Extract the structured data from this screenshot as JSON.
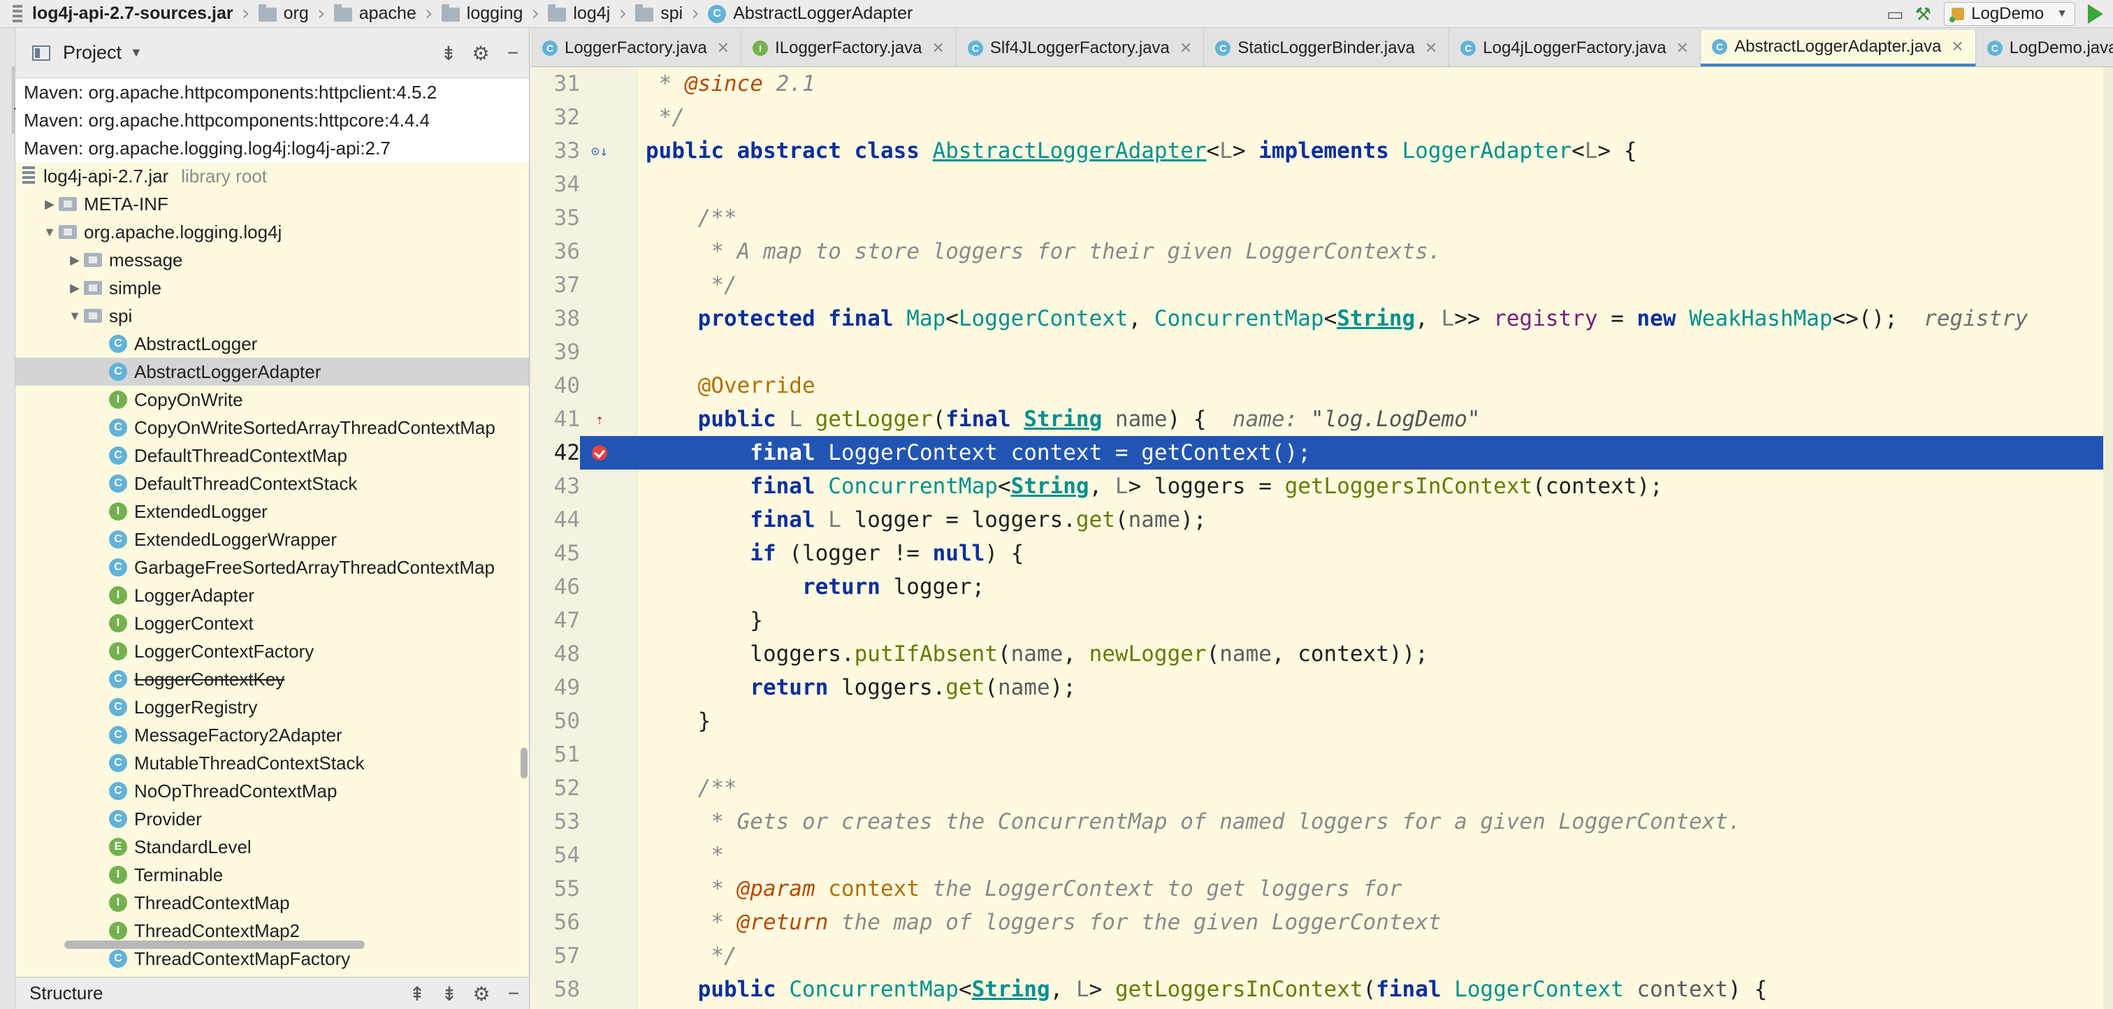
{
  "navbar": {
    "crumbs": [
      {
        "label": "log4j-api-2.7-sources.jar",
        "type": "jar"
      },
      {
        "label": "org",
        "type": "folder"
      },
      {
        "label": "apache",
        "type": "folder"
      },
      {
        "label": "logging",
        "type": "folder"
      },
      {
        "label": "log4j",
        "type": "folder"
      },
      {
        "label": "spi",
        "type": "folder"
      },
      {
        "label": "AbstractLoggerAdapter",
        "type": "class"
      }
    ],
    "run_config": "LogDemo",
    "icons": [
      "layout-icon",
      "build-hammer-icon",
      "run-icon"
    ]
  },
  "toolstrip": {
    "label": "1: Project"
  },
  "project_panel": {
    "title": "Project",
    "header_icons": [
      "collapse-icon",
      "gear-icon",
      "minimize-icon"
    ],
    "tree": [
      {
        "label": "Maven: org.apache.httpcomponents:httpclient:4.5.2",
        "depth": 0,
        "kind": "lib"
      },
      {
        "label": "Maven: org.apache.httpcomponents:httpcore:4.4.4",
        "depth": 0,
        "kind": "lib"
      },
      {
        "label": "Maven: org.apache.logging.log4j:log4j-api:2.7",
        "depth": 0,
        "kind": "lib"
      },
      {
        "label": "log4j-api-2.7.jar",
        "suffix": "library root",
        "depth": 0,
        "kind": "jar"
      },
      {
        "label": "META-INF",
        "depth": 1,
        "kind": "folder",
        "expander": "collapsed"
      },
      {
        "label": "org.apache.logging.log4j",
        "depth": 1,
        "kind": "package",
        "expander": "expanded"
      },
      {
        "label": "message",
        "depth": 2,
        "kind": "package",
        "expander": "collapsed"
      },
      {
        "label": "simple",
        "depth": 2,
        "kind": "package",
        "expander": "collapsed"
      },
      {
        "label": "spi",
        "depth": 2,
        "kind": "package",
        "expander": "expanded"
      },
      {
        "label": "AbstractLogger",
        "depth": 3,
        "kind": "class"
      },
      {
        "label": "AbstractLoggerAdapter",
        "depth": 3,
        "kind": "class",
        "selected": true
      },
      {
        "label": "CopyOnWrite",
        "depth": 3,
        "kind": "interface"
      },
      {
        "label": "CopyOnWriteSortedArrayThreadContextMap",
        "depth": 3,
        "kind": "class"
      },
      {
        "label": "DefaultThreadContextMap",
        "depth": 3,
        "kind": "class"
      },
      {
        "label": "DefaultThreadContextStack",
        "depth": 3,
        "kind": "class"
      },
      {
        "label": "ExtendedLogger",
        "depth": 3,
        "kind": "interface"
      },
      {
        "label": "ExtendedLoggerWrapper",
        "depth": 3,
        "kind": "class"
      },
      {
        "label": "GarbageFreeSortedArrayThreadContextMap",
        "depth": 3,
        "kind": "class"
      },
      {
        "label": "LoggerAdapter",
        "depth": 3,
        "kind": "interface"
      },
      {
        "label": "LoggerContext",
        "depth": 3,
        "kind": "interface"
      },
      {
        "label": "LoggerContextFactory",
        "depth": 3,
        "kind": "interface"
      },
      {
        "label": "LoggerContextKey",
        "depth": 3,
        "kind": "class",
        "deprecated": true
      },
      {
        "label": "LoggerRegistry",
        "depth": 3,
        "kind": "class"
      },
      {
        "label": "MessageFactory2Adapter",
        "depth": 3,
        "kind": "class"
      },
      {
        "label": "MutableThreadContextStack",
        "depth": 3,
        "kind": "class"
      },
      {
        "label": "NoOpThreadContextMap",
        "depth": 3,
        "kind": "class"
      },
      {
        "label": "Provider",
        "depth": 3,
        "kind": "class"
      },
      {
        "label": "StandardLevel",
        "depth": 3,
        "kind": "enum"
      },
      {
        "label": "Terminable",
        "depth": 3,
        "kind": "interface"
      },
      {
        "label": "ThreadContextMap",
        "depth": 3,
        "kind": "interface"
      },
      {
        "label": "ThreadContextMap2",
        "depth": 3,
        "kind": "interface"
      },
      {
        "label": "ThreadContextMapFactory",
        "depth": 3,
        "kind": "class"
      }
    ],
    "structure_title": "Structure"
  },
  "tabs": [
    {
      "label": "LoggerFactory.java",
      "kind": "class",
      "active": false
    },
    {
      "label": "ILoggerFactory.java",
      "kind": "interface",
      "active": false
    },
    {
      "label": "Slf4JLoggerFactory.java",
      "kind": "class",
      "active": false
    },
    {
      "label": "StaticLoggerBinder.java",
      "kind": "class",
      "active": false
    },
    {
      "label": "Log4jLoggerFactory.java",
      "kind": "class",
      "active": false
    },
    {
      "label": "AbstractLoggerAdapter.java",
      "kind": "class",
      "active": true
    },
    {
      "label": "LogDemo.java",
      "kind": "class",
      "active": false
    }
  ],
  "editor": {
    "current_line": 42,
    "lines": [
      {
        "n": 31,
        "tokens": [
          [
            "cm",
            " * "
          ],
          [
            "tag",
            "@since"
          ],
          [
            "cm",
            " 2.1"
          ]
        ]
      },
      {
        "n": 32,
        "tokens": [
          [
            "cm",
            " */"
          ]
        ]
      },
      {
        "n": 33,
        "mark": "implements",
        "tokens": [
          [
            "kw",
            "public abstract class "
          ],
          [
            "clsdecl",
            "AbstractLoggerAdapter"
          ],
          [
            "punct",
            "<"
          ],
          [
            "tp",
            "L"
          ],
          [
            "punct",
            "> "
          ],
          [
            "kw",
            "implements "
          ],
          [
            "ty",
            "LoggerAdapter"
          ],
          [
            "punct",
            "<"
          ],
          [
            "tp",
            "L"
          ],
          [
            "punct",
            "> {"
          ]
        ]
      },
      {
        "n": 34,
        "tokens": []
      },
      {
        "n": 35,
        "tokens": [
          [
            "cm",
            "    /**"
          ]
        ]
      },
      {
        "n": 36,
        "tokens": [
          [
            "cm",
            "     * A map to store loggers for their given LoggerContexts."
          ]
        ]
      },
      {
        "n": 37,
        "tokens": [
          [
            "cm",
            "     */"
          ]
        ]
      },
      {
        "n": 38,
        "tokens": [
          [
            "punct",
            "    "
          ],
          [
            "kw",
            "protected final "
          ],
          [
            "ty",
            "Map"
          ],
          [
            "punct",
            "<"
          ],
          [
            "ty",
            "LoggerContext"
          ],
          [
            "punct",
            ", "
          ],
          [
            "ty",
            "ConcurrentMap"
          ],
          [
            "punct",
            "<"
          ],
          [
            "tyu",
            "String"
          ],
          [
            "punct",
            ", "
          ],
          [
            "tp",
            "L"
          ],
          [
            "punct",
            ">> "
          ],
          [
            "fld",
            "registry"
          ],
          [
            "punct",
            " = "
          ],
          [
            "kw",
            "new "
          ],
          [
            "ty",
            "WeakHashMap"
          ],
          [
            "punct",
            "<>();  "
          ],
          [
            "hint",
            "registry"
          ]
        ]
      },
      {
        "n": 39,
        "tokens": []
      },
      {
        "n": 40,
        "tokens": [
          [
            "punct",
            "    "
          ],
          [
            "ann",
            "@Override"
          ]
        ]
      },
      {
        "n": 41,
        "mark": "override",
        "tokens": [
          [
            "punct",
            "    "
          ],
          [
            "kw",
            "public "
          ],
          [
            "tp",
            "L "
          ],
          [
            "fn",
            "getLogger"
          ],
          [
            "punct",
            "("
          ],
          [
            "kw",
            "final "
          ],
          [
            "tyu",
            "String"
          ],
          [
            "prm",
            " name"
          ],
          [
            "punct",
            ") {  "
          ],
          [
            "hint",
            "name: "
          ],
          [
            "hint-str",
            "\"log.LogDemo\""
          ]
        ]
      },
      {
        "n": 42,
        "mark": "breakpoint",
        "tokens": [
          [
            "punct",
            "        "
          ],
          [
            "kw",
            "final "
          ],
          [
            "ty",
            "LoggerContext"
          ],
          [
            "punct",
            " context = "
          ],
          [
            "fn",
            "getContext"
          ],
          [
            "punct",
            "();"
          ]
        ]
      },
      {
        "n": 43,
        "tokens": [
          [
            "punct",
            "        "
          ],
          [
            "kw",
            "final "
          ],
          [
            "ty",
            "ConcurrentMap"
          ],
          [
            "punct",
            "<"
          ],
          [
            "tyu",
            "String"
          ],
          [
            "punct",
            ", "
          ],
          [
            "tp",
            "L"
          ],
          [
            "punct",
            "> loggers = "
          ],
          [
            "fn",
            "getLoggersInContext"
          ],
          [
            "punct",
            "(context);"
          ]
        ]
      },
      {
        "n": 44,
        "tokens": [
          [
            "punct",
            "        "
          ],
          [
            "kw",
            "final "
          ],
          [
            "tp",
            "L"
          ],
          [
            "punct",
            " logger = loggers."
          ],
          [
            "fn",
            "get"
          ],
          [
            "punct",
            "("
          ],
          [
            "prm",
            "name"
          ],
          [
            "punct",
            ");"
          ]
        ]
      },
      {
        "n": 45,
        "tokens": [
          [
            "punct",
            "        "
          ],
          [
            "kw",
            "if "
          ],
          [
            "punct",
            "(logger != "
          ],
          [
            "kw",
            "null"
          ],
          [
            "punct",
            ") {"
          ]
        ]
      },
      {
        "n": 46,
        "tokens": [
          [
            "punct",
            "            "
          ],
          [
            "kw",
            "return "
          ],
          [
            "punct",
            "logger;"
          ]
        ]
      },
      {
        "n": 47,
        "tokens": [
          [
            "punct",
            "        }"
          ]
        ]
      },
      {
        "n": 48,
        "tokens": [
          [
            "punct",
            "        loggers."
          ],
          [
            "fn",
            "putIfAbsent"
          ],
          [
            "punct",
            "("
          ],
          [
            "prm",
            "name"
          ],
          [
            "punct",
            ", "
          ],
          [
            "fn",
            "newLogger"
          ],
          [
            "punct",
            "("
          ],
          [
            "prm",
            "name"
          ],
          [
            "punct",
            ", context));"
          ]
        ]
      },
      {
        "n": 49,
        "tokens": [
          [
            "punct",
            "        "
          ],
          [
            "kw",
            "return "
          ],
          [
            "punct",
            "loggers."
          ],
          [
            "fn",
            "get"
          ],
          [
            "punct",
            "("
          ],
          [
            "prm",
            "name"
          ],
          [
            "punct",
            ");"
          ]
        ]
      },
      {
        "n": 50,
        "tokens": [
          [
            "punct",
            "    }"
          ]
        ]
      },
      {
        "n": 51,
        "tokens": []
      },
      {
        "n": 52,
        "tokens": [
          [
            "cm",
            "    /**"
          ]
        ]
      },
      {
        "n": 53,
        "tokens": [
          [
            "cm",
            "     * Gets or creates the ConcurrentMap of named loggers for a given LoggerContext."
          ]
        ]
      },
      {
        "n": 54,
        "tokens": [
          [
            "cm",
            "     *"
          ]
        ]
      },
      {
        "n": 55,
        "tokens": [
          [
            "cm",
            "     * "
          ],
          [
            "tag",
            "@param"
          ],
          [
            "ann",
            " context"
          ],
          [
            "cm",
            " the LoggerContext to get loggers for"
          ]
        ]
      },
      {
        "n": 56,
        "tokens": [
          [
            "cm",
            "     * "
          ],
          [
            "tag",
            "@return"
          ],
          [
            "cm",
            " the map of loggers for the given LoggerContext"
          ]
        ]
      },
      {
        "n": 57,
        "tokens": [
          [
            "cm",
            "     */"
          ]
        ]
      },
      {
        "n": 58,
        "tokens": [
          [
            "punct",
            "    "
          ],
          [
            "kw",
            "public "
          ],
          [
            "ty",
            "ConcurrentMap"
          ],
          [
            "punct",
            "<"
          ],
          [
            "tyu",
            "String"
          ],
          [
            "punct",
            ", "
          ],
          [
            "tp",
            "L"
          ],
          [
            "punct",
            "> "
          ],
          [
            "fn",
            "getLoggersInContext"
          ],
          [
            "punct",
            "("
          ],
          [
            "kw",
            "final "
          ],
          [
            "ty",
            "LoggerContext"
          ],
          [
            "prm",
            " context"
          ],
          [
            "punct",
            ") {"
          ]
        ]
      }
    ]
  }
}
